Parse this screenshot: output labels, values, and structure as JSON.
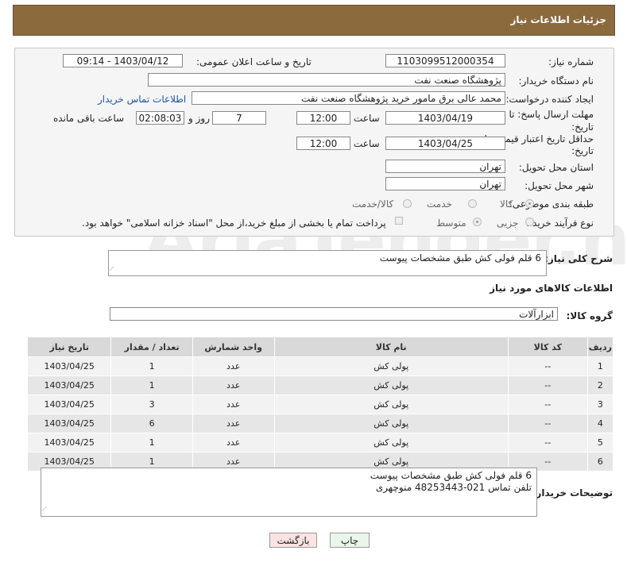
{
  "header": {
    "title": "جزئیات اطلاعات نیاز"
  },
  "watermark": "AriaTender.neT",
  "form": {
    "need_number": {
      "label": "شماره نیاز:",
      "value": "1103099512000354"
    },
    "announce_datetime": {
      "label": "تاریخ و ساعت اعلان عمومی:",
      "value": "1403/04/12 - 09:14"
    },
    "buyer_org": {
      "label": "نام دستگاه خریدار:",
      "value": "پژوهشگاه صنعت نفت"
    },
    "requester": {
      "label": "ایجاد کننده درخواست:",
      "value": "محمد عالی برق مامور خرید پژوهشگاه صنعت نفت",
      "contact_link": "اطلاعات تماس خریدار"
    },
    "reply_deadline": {
      "label_line1": "مهلت ارسال پاسخ: تا",
      "label_line2": "تاریخ:",
      "date": "1403/04/19",
      "time_label": "ساعت",
      "time": "12:00",
      "days": "7",
      "days_label": "روز و",
      "remaining": "02:08:03",
      "remaining_label": "ساعت باقی مانده"
    },
    "price_validity": {
      "label_line1": "حداقل تاریخ اعتبار قیمت: تا",
      "label_line2": "تاریخ:",
      "date": "1403/04/25",
      "time_label": "ساعت",
      "time": "12:00"
    },
    "delivery_province": {
      "label": "استان محل تحویل:",
      "value": "تهران"
    },
    "delivery_city": {
      "label": "شهر محل تحویل:",
      "value": "تهران"
    },
    "category": {
      "label": "طبقه بندی موضوعی:",
      "options": [
        "کالا",
        "خدمت",
        "کالا/خدمت"
      ],
      "selected": "کالا"
    },
    "purchase_process": {
      "label": "نوع فرآیند خرید :",
      "options": [
        "جزیی",
        "متوسط"
      ],
      "selected": "متوسط",
      "payment_note": "پرداخت تمام یا بخشی از مبلغ خرید،از محل \"اسناد خزانه اسلامی\" خواهد بود."
    }
  },
  "general_description": {
    "label": "شرح کلی نیاز:",
    "value": "6 قلم فولی کش طبق مشخصات پیوست"
  },
  "goods_info_title": "اطلاعات کالاهای مورد نیاز",
  "goods_group": {
    "label": "گروه کالا:",
    "value": "ابزارآلات"
  },
  "table": {
    "headers": [
      "ردیف",
      "کد کالا",
      "نام کالا",
      "واحد شمارش",
      "تعداد / مقدار",
      "تاریخ نیاز"
    ],
    "rows": [
      [
        "1",
        "--",
        "پولی کش",
        "عدد",
        "1",
        "1403/04/25"
      ],
      [
        "2",
        "--",
        "پولی کش",
        "عدد",
        "1",
        "1403/04/25"
      ],
      [
        "3",
        "--",
        "پولی کش",
        "عدد",
        "3",
        "1403/04/25"
      ],
      [
        "4",
        "--",
        "پولی کش",
        "عدد",
        "6",
        "1403/04/25"
      ],
      [
        "5",
        "--",
        "پولی کش",
        "عدد",
        "1",
        "1403/04/25"
      ],
      [
        "6",
        "--",
        "پولی کش",
        "عدد",
        "1",
        "1403/04/25"
      ]
    ]
  },
  "buyer_notes": {
    "label": "توضیحات خریدار:",
    "line1": "6 قلم فولی کش طبق مشخصات پیوست",
    "line2": "تلفن تماس 021-48253443 منوچهری"
  },
  "buttons": {
    "print": "چاپ",
    "back": "بازگشت"
  }
}
